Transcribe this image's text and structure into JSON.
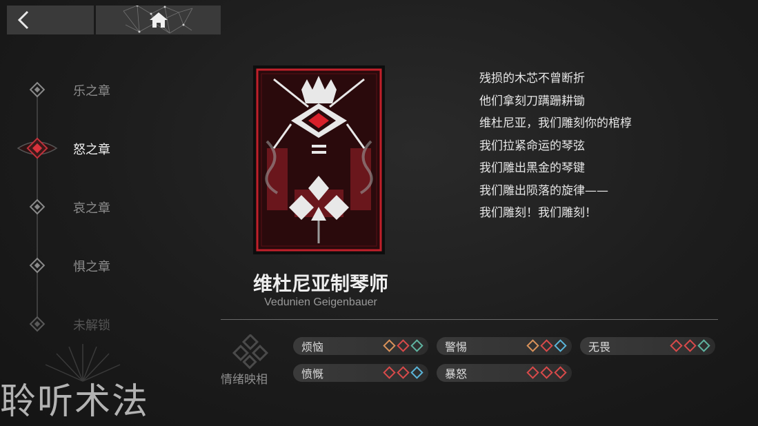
{
  "topbar": {
    "back_icon": "chevron-left-icon",
    "home_icon": "home-icon"
  },
  "chapters": [
    {
      "label": "乐之章",
      "state": "normal"
    },
    {
      "label": "怒之章",
      "state": "active"
    },
    {
      "label": "哀之章",
      "state": "normal"
    },
    {
      "label": "惧之章",
      "state": "normal"
    },
    {
      "label": "未解锁",
      "state": "locked"
    }
  ],
  "song": {
    "name_cn": "维杜尼亚制琴师",
    "name_en": "Vedunien Geigenbauer",
    "card_colors": {
      "frame": "#c0202a",
      "accent": "#e8e8e8",
      "bg": "#2a0a0c"
    }
  },
  "poem": [
    "残损的木芯不曾断折",
    "他们拿刻刀蹒跚耕锄",
    "维杜尼亚，我们雕刻你的棺椁",
    "我们拉紧命运的琴弦",
    "我们雕出黑金的琴键",
    "我们雕出陨落的旋律——",
    "我们雕刻！我们雕刻！"
  ],
  "emotions": {
    "title": "情绪映相",
    "tags": [
      {
        "name": "烦恼",
        "gems": [
          "orange",
          "red",
          "teal"
        ]
      },
      {
        "name": "警惕",
        "gems": [
          "orange",
          "red",
          "blue"
        ]
      },
      {
        "name": "无畏",
        "gems": [
          "red",
          "red",
          "teal"
        ]
      },
      {
        "name": "愤慨",
        "gems": [
          "red",
          "red",
          "blue"
        ]
      },
      {
        "name": "暴怒",
        "gems": [
          "red",
          "red",
          "red"
        ]
      }
    ]
  },
  "colors": {
    "red": "#d84a4a",
    "orange": "#d9925a",
    "teal": "#5fb3a0",
    "blue": "#5ab4d8"
  },
  "watermark": "聆听术法"
}
